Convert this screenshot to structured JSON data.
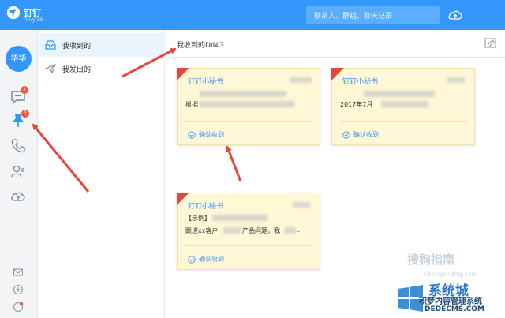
{
  "app": {
    "name": "钉钉",
    "sub": "DingTalk"
  },
  "search": {
    "placeholder": "联系人、群组、聊天记录"
  },
  "user": {
    "avatar_text": "华华"
  },
  "badges": {
    "messages": "2",
    "ding": "3"
  },
  "nav": {
    "received": "我收到的",
    "sent": "我发出的"
  },
  "main": {
    "title": "我收到的DING"
  },
  "cards": [
    {
      "sender": "钉钉小秘书",
      "line1": "",
      "line2": "根据",
      "confirm": "确认收到"
    },
    {
      "sender": "钉钉小秘书",
      "line1": "",
      "line2": "2017年7月",
      "confirm": "确认收到"
    },
    {
      "sender": "钉钉小秘书",
      "line1": "【示例】",
      "line2": "跟进xx客户",
      "line2b": "产品问题，我",
      "line2c": "...",
      "confirm": "确认收到"
    }
  ],
  "watermark": {
    "sogou": "搜狗指南",
    "sogou_url": "xitongcheng.com",
    "brand": "系统城",
    "brand_cn": "积梦内容管理系统",
    "domain": "DEDECMS.COM"
  },
  "colors": {
    "titlebar": "#3296fa",
    "accent": "#3296fa",
    "card_bg": "#fff7d6",
    "badge": "#f25643",
    "arrow": "#e8453c"
  }
}
